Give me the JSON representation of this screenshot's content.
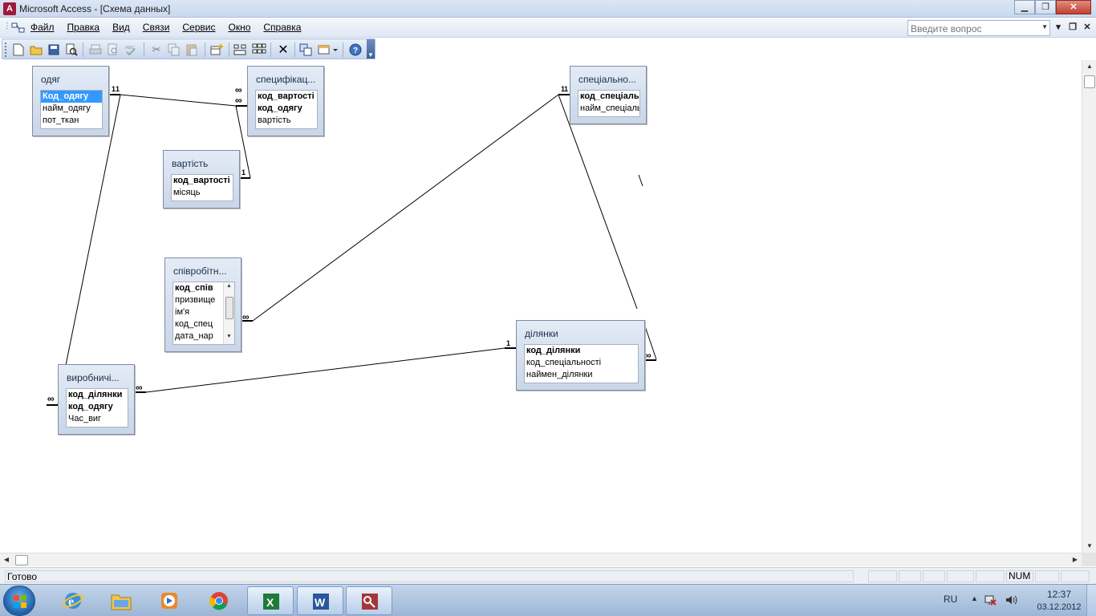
{
  "window": {
    "app_title": "Microsoft Access - [Схема данных]"
  },
  "menu": {
    "items": [
      "Файл",
      "Правка",
      "Вид",
      "Связи",
      "Сервис",
      "Окно",
      "Справка"
    ],
    "help_placeholder": "Введите вопрос"
  },
  "toolbar": {
    "icons": [
      "new-icon",
      "open-icon",
      "save-icon",
      "file-search-icon",
      "print-icon",
      "print-preview-icon",
      "spelling-icon",
      "cut-icon",
      "copy-icon",
      "paste-icon",
      "show-table-icon",
      "show-direct-icon",
      "show-all-icon",
      "delete-icon",
      "relationships-icon",
      "new-object-icon",
      "help-icon"
    ]
  },
  "tables": {
    "odiag": {
      "name": "одяг",
      "fields": [
        "Код_одягу",
        "найм_одягу",
        "пот_ткан"
      ]
    },
    "spec": {
      "name": "специфікац...",
      "fields": [
        "код_вартості",
        "код_одягу",
        "вартість"
      ]
    },
    "vartist": {
      "name": "вартість",
      "fields": [
        "код_вартості",
        "місяць"
      ]
    },
    "spetsial": {
      "name": "спеціально...",
      "fields": [
        "код_спеціальн",
        "найм_спеціальн"
      ]
    },
    "spivrob": {
      "name": "співробітн...",
      "fields": [
        "код_спів",
        "призвище",
        "ім'я",
        "код_спец",
        "дата_нар"
      ]
    },
    "dilyanky": {
      "name": "ділянки",
      "fields": [
        "код_ділянки",
        "код_спеціальності",
        "наймен_ділянки"
      ]
    },
    "vyrob": {
      "name": "виробничі...",
      "fields": [
        "код_ділянки",
        "код_одягу",
        "Час_виг"
      ]
    }
  },
  "relationships": {
    "one_label": "1",
    "many_label": "∞"
  },
  "statusbar": {
    "text": "Готово",
    "num": "NUM"
  },
  "taskbar": {
    "apps": [
      "ie-icon",
      "explorer-icon",
      "media-player-icon",
      "chrome-icon",
      "excel-icon",
      "word-icon",
      "access-icon"
    ],
    "lang": "RU",
    "time": "12:37",
    "date": "03.12.2012"
  }
}
